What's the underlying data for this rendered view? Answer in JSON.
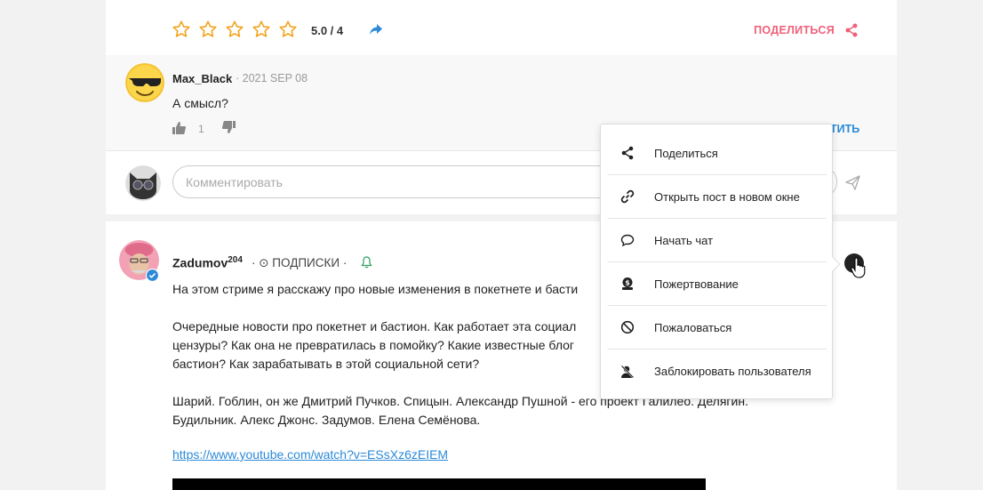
{
  "rating": {
    "stars": 5,
    "value_text": "5.0 / 4",
    "share_label": "ПОДЕЛИТЬСЯ"
  },
  "comment": {
    "author": "Max_Black",
    "date": "· 2021 SEP 08",
    "text": "А смысл?",
    "likes": "1",
    "reply_tail": "ТИТЬ"
  },
  "comment_input": {
    "placeholder": "Комментировать"
  },
  "post": {
    "author": "Zadumov",
    "author_rep": "204",
    "subscriptions": "· ⊙ ПОДПИСКИ ·",
    "lines": [
      "На этом стриме я расскажу про новые изменения в покетнете и басти",
      "",
      "Очередные новости про покетнет и бастион. Как работает эта социал",
      "цензуры? Как она не превратилась в помойку? Какие известные блог",
      "бастион? Как зарабатывать в этой социальной сети?",
      "",
      "Шарий. Гоблин, он же Дмитрий Пучков. Спицын. Александр Пушной - его проект Галилео. Делягин.",
      "Будильник. Алекс Джонс. Задумов. Елена Семёнова."
    ],
    "link": "https://www.youtube.com/watch?v=ESsXz6zEIEM"
  },
  "menu": {
    "items": [
      {
        "label": "Поделиться",
        "icon": "share-icon"
      },
      {
        "label": "Открыть пост в новом окне",
        "icon": "link-icon"
      },
      {
        "label": "Начать чат",
        "icon": "chat-icon"
      },
      {
        "label": "Пожертвование",
        "icon": "donate-icon"
      },
      {
        "label": "Пожаловаться",
        "icon": "block-icon"
      },
      {
        "label": "Заблокировать пользователя",
        "icon": "block-user-icon"
      }
    ]
  },
  "colors": {
    "star": "#f2a623",
    "accent_pink": "#f0617a",
    "link_blue": "#2b8ad8"
  }
}
